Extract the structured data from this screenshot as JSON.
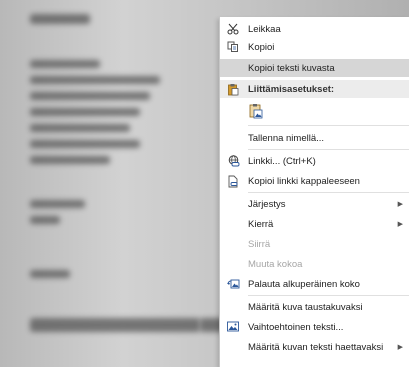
{
  "menu": {
    "items": [
      {
        "key": "cut",
        "label": "Leikkaa",
        "icon": "scissors-icon"
      },
      {
        "key": "copy",
        "label": "Kopioi",
        "icon": "copy-icon"
      },
      {
        "key": "copy_text",
        "label": "Kopioi teksti kuvasta"
      },
      {
        "key": "paste_options",
        "label": "Liittämisasetukset:",
        "icon": "clipboard-icon"
      },
      {
        "key": "paste_picture",
        "label": "",
        "icon": "paste-picture-icon"
      },
      {
        "key": "save_as",
        "label": "Tallenna nimellä..."
      },
      {
        "key": "link",
        "label": "Linkki... (Ctrl+K)",
        "icon": "link-icon"
      },
      {
        "key": "copy_link",
        "label": "Kopioi linkki kappaleeseen",
        "icon": "copy-link-icon"
      },
      {
        "key": "order",
        "label": "Järjestys"
      },
      {
        "key": "rotate",
        "label": "Kierrä"
      },
      {
        "key": "move",
        "label": "Siirrä"
      },
      {
        "key": "resize",
        "label": "Muuta kokoa"
      },
      {
        "key": "reset_size",
        "label": "Palauta alkuperäinen koko",
        "icon": "reset-picture-icon"
      },
      {
        "key": "set_background",
        "label": "Määritä kuva taustakuvaksi"
      },
      {
        "key": "alt_text",
        "label": "Vaihtoehtoinen teksti...",
        "icon": "alt-text-icon"
      },
      {
        "key": "set_text_watermark",
        "label": "Määritä kuvan teksti haettavaksi"
      }
    ]
  },
  "colors": {
    "highlight": "#d6d6d6",
    "accent": "#2b579a",
    "paste_orange": "#d59b2b"
  }
}
